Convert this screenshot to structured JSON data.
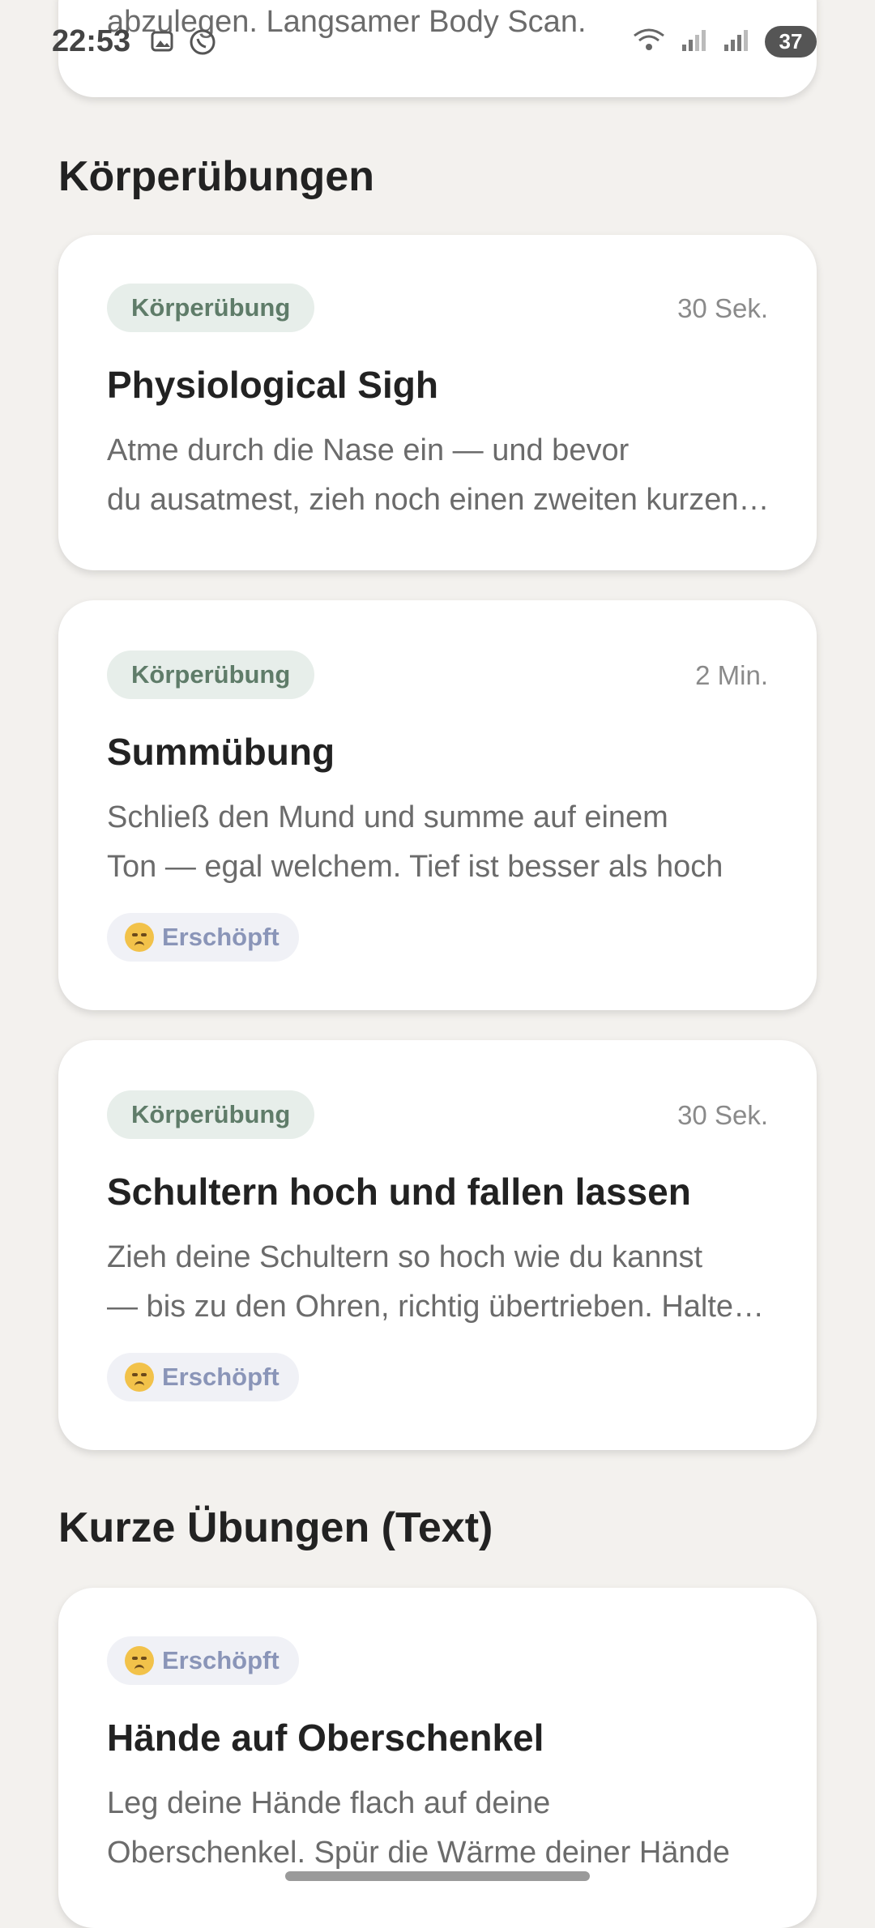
{
  "status": {
    "time": "22:53",
    "battery": "37",
    "left_icons": [
      "gallery-icon",
      "whatsapp-icon"
    ],
    "right_icons": [
      "wifi-icon",
      "signal-icon",
      "signal-icon"
    ]
  },
  "top_card": {
    "desc_partial": "abzulegen. Langsamer Body Scan."
  },
  "sections": [
    {
      "title": "Körperübungen",
      "cards": [
        {
          "tag": "Körperübung",
          "duration": "30 Sek.",
          "title": "Physiological Sigh",
          "desc_line1": "Atme durch die Nase ein — und bevor",
          "desc_line2": "du ausatmest, zieh noch einen zweiten kurzen Atemzug nach",
          "mood": ""
        },
        {
          "tag": "Körperübung",
          "duration": "2 Min.",
          "title": "Summübung",
          "desc_line1": "Schließ den Mund und summe auf einem",
          "desc_line2": "Ton — egal welchem. Tief ist besser als hoch",
          "mood": "Erschöpft"
        },
        {
          "tag": "Körperübung",
          "duration": "30 Sek.",
          "title": "Schultern hoch und fallen lassen",
          "desc_line1": "Zieh deine Schultern so hoch wie du kannst",
          "desc_line2": "— bis zu den Ohren, richtig übertrieben. Halte sie dort",
          "mood": "Erschöpft"
        }
      ]
    },
    {
      "title": "Kurze Übungen (Text)",
      "cards": [
        {
          "mood": "Erschöpft",
          "title": "Hände auf Oberschenkel",
          "desc_line1": "Leg deine Hände flach auf deine",
          "desc_line2": "Oberschenkel. Spür die Wärme deiner Hände"
        }
      ]
    }
  ]
}
